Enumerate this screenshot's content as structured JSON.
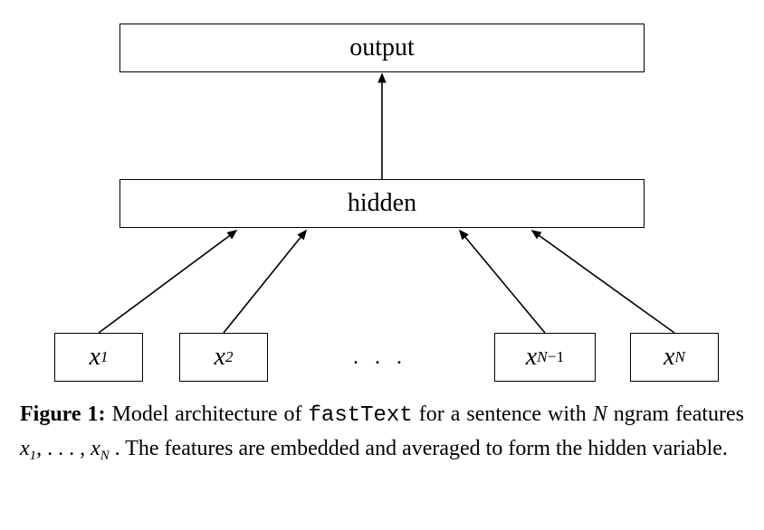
{
  "diagram": {
    "output_label": "output",
    "hidden_label": "hidden",
    "inputs": {
      "x1": {
        "base": "x",
        "sub": "1"
      },
      "x2": {
        "base": "x",
        "sub": "2"
      },
      "ellipsis": ". . .",
      "xNm1": {
        "base": "x",
        "sub_lhs": "N",
        "sub_op": "−",
        "sub_rhs": "1"
      },
      "xN": {
        "base": "x",
        "sub": "N"
      }
    }
  },
  "caption": {
    "figure_label": "Figure 1:",
    "pre_code": " Model architecture of ",
    "code": "fastText",
    "post_code_1": " for a sentence with ",
    "N": "N",
    "post_N": " ngram features ",
    "x_base": "x",
    "sub1": "1",
    "list_sep": ", . . . , ",
    "subN": "N",
    "after_list": " . The features are embedded and averaged to form the hidden variable."
  }
}
